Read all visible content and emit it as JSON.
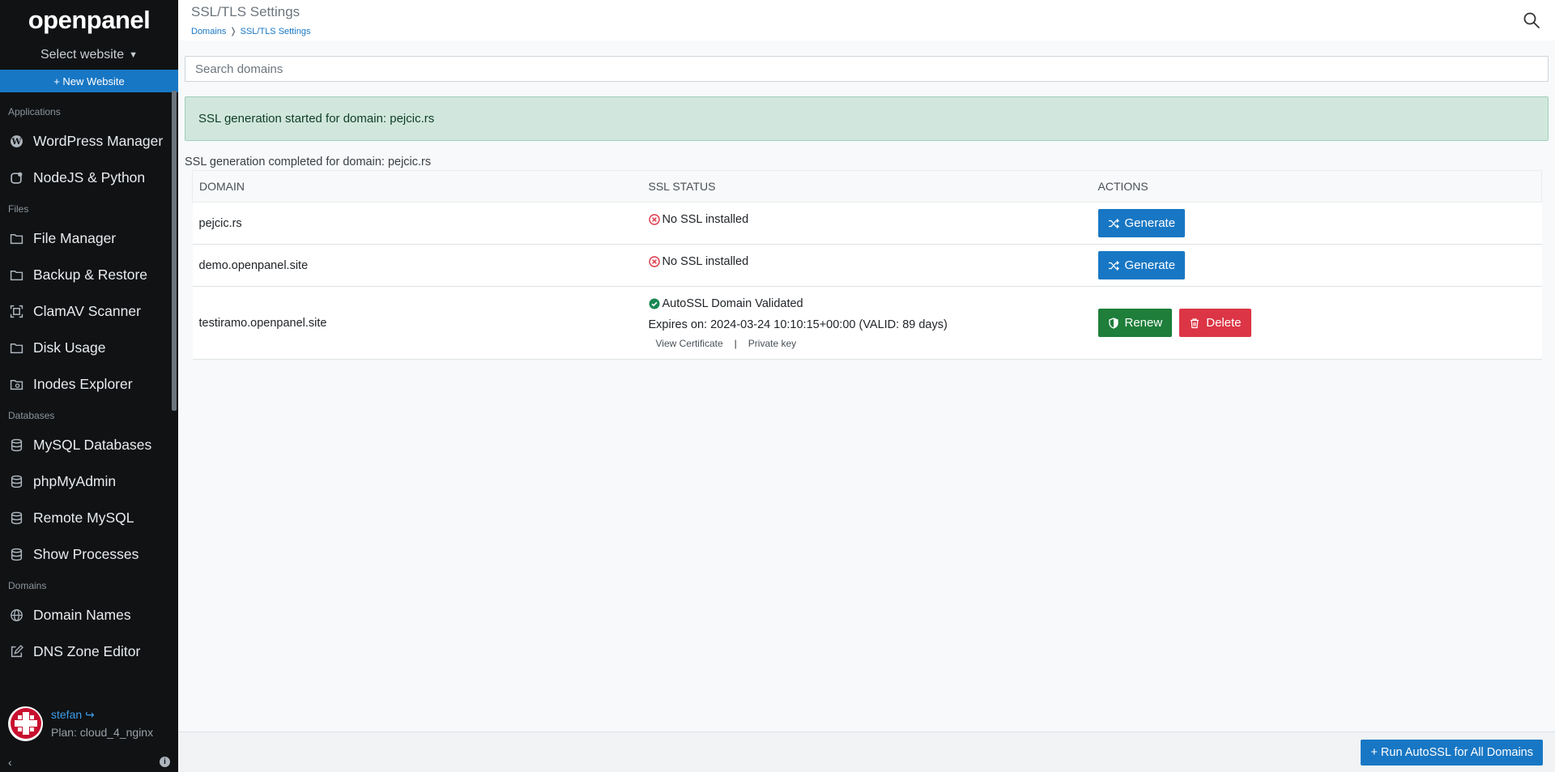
{
  "app": {
    "logo": "openpanel"
  },
  "sidebar": {
    "site_select": "Select website",
    "new_website": "+ New Website",
    "sections": [
      {
        "title": "Applications",
        "items": [
          {
            "label": "WordPress Manager",
            "icon": "wordpress-icon"
          },
          {
            "label": "NodeJS & Python",
            "icon": "plugin-icon"
          }
        ]
      },
      {
        "title": "Files",
        "items": [
          {
            "label": "File Manager",
            "icon": "folder-icon"
          },
          {
            "label": "Backup & Restore",
            "icon": "folder-icon"
          },
          {
            "label": "ClamAV Scanner",
            "icon": "scan-icon"
          },
          {
            "label": "Disk Usage",
            "icon": "folder-icon"
          },
          {
            "label": "Inodes Explorer",
            "icon": "folder-search-icon"
          }
        ]
      },
      {
        "title": "Databases",
        "items": [
          {
            "label": "MySQL Databases",
            "icon": "database-icon"
          },
          {
            "label": "phpMyAdmin",
            "icon": "database-icon"
          },
          {
            "label": "Remote MySQL",
            "icon": "database-icon"
          },
          {
            "label": "Show Processes",
            "icon": "database-icon"
          }
        ]
      },
      {
        "title": "Domains",
        "items": [
          {
            "label": "Domain Names",
            "icon": "globe-icon"
          },
          {
            "label": "DNS Zone Editor",
            "icon": "edit-icon"
          }
        ]
      }
    ],
    "user": {
      "name": "stefan",
      "plan": "Plan: cloud_4_nginx"
    }
  },
  "header": {
    "title": "SSL/TLS Settings",
    "breadcrumb": [
      "Domains",
      "SSL/TLS Settings"
    ]
  },
  "search": {
    "placeholder": "Search domains"
  },
  "alert": {
    "text": "SSL generation started for domain: pejcic.rs"
  },
  "status_line": "SSL generation completed for domain: pejcic.rs",
  "table": {
    "headers": [
      "DOMAIN",
      "SSL STATUS",
      "ACTIONS"
    ],
    "rows": [
      {
        "domain": "pejcic.rs",
        "status": "No SSL installed",
        "action": "Generate"
      },
      {
        "domain": "demo.openpanel.site",
        "status": "No SSL installed",
        "action": "Generate"
      },
      {
        "domain": "testiramo.openpanel.site",
        "status": "AutoSSL Domain Validated",
        "expires": "Expires on: 2024-03-24 10:10:15+00:00 (VALID: 89 days)",
        "view_cert": "View Certificate",
        "divider": "|",
        "private_key": "Private key",
        "action_renew": "Renew",
        "action_delete": "Delete"
      }
    ]
  },
  "footer": {
    "autossl_button": "+ Run AutoSSL for All Domains"
  },
  "colors": {
    "primary": "#1877c4",
    "success": "#1e7e3a",
    "danger": "#dc3545",
    "sidebar_bg": "#101214",
    "alert_bg": "#d1e7dd"
  }
}
